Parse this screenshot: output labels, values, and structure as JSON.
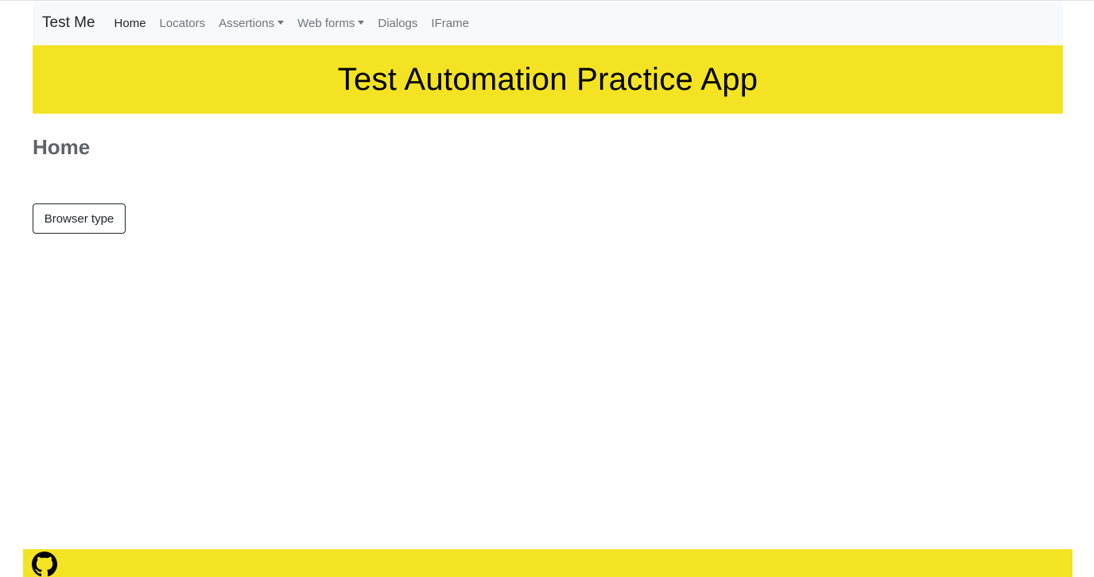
{
  "navbar": {
    "brand": "Test Me",
    "items": [
      {
        "label": "Home",
        "active": true,
        "dropdown": false
      },
      {
        "label": "Locators",
        "active": false,
        "dropdown": false
      },
      {
        "label": "Assertions",
        "active": false,
        "dropdown": true
      },
      {
        "label": "Web forms",
        "active": false,
        "dropdown": true
      },
      {
        "label": "Dialogs",
        "active": false,
        "dropdown": false
      },
      {
        "label": "IFrame",
        "active": false,
        "dropdown": false
      }
    ]
  },
  "banner": {
    "title": "Test Automation Practice App"
  },
  "main": {
    "heading": "Home",
    "browser_type_button": "Browser type"
  },
  "footer": {
    "icon": "github-icon"
  },
  "colors": {
    "accent_yellow": "#f4e323",
    "navbar_bg": "#f8f9fa",
    "muted_text": "#6c757d"
  }
}
